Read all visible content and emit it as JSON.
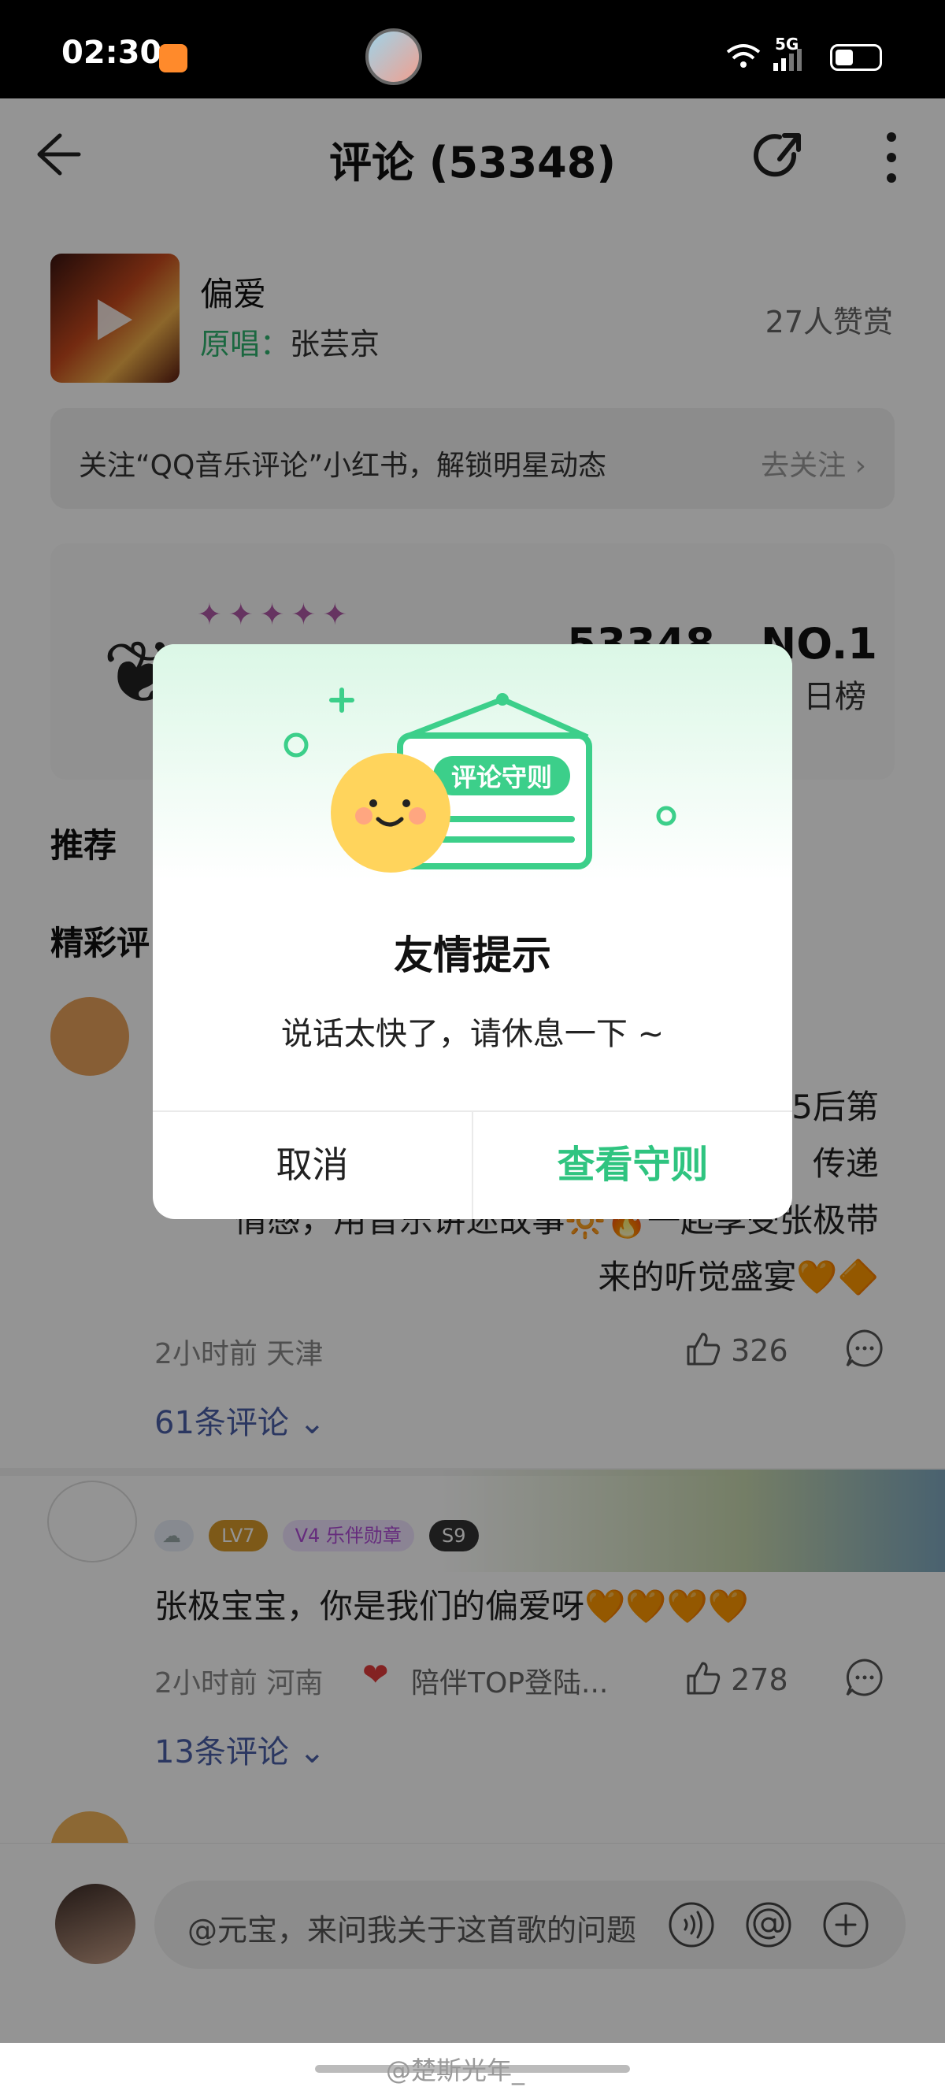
{
  "status_bar": {
    "time": "02:30",
    "network": "5G"
  },
  "header": {
    "title": "评论 (53348)"
  },
  "song": {
    "title": "偏爱",
    "original_label": "原唱：",
    "singer": "张芸京",
    "likes": "27人赞赏"
  },
  "follow_banner": {
    "text": "关注“QQ音乐评论”小红书，解锁明星动态",
    "action": "去关注 ›"
  },
  "stats": {
    "stars": "✦✦✦✦✦",
    "count": "53348",
    "rank": "NO.1",
    "rank_label": "日榜"
  },
  "sections": {
    "recommend": "推荐",
    "hot": "精彩评"
  },
  "comments": [
    {
      "text_visible": "5后第\n传递\n情感，用音乐讲述故事🔆🔥一起享受张极带\n来的听觉盛宴🧡🔶",
      "time_place": "2小时前 天津",
      "likes": "326",
      "replies": "61条评论 ⌄"
    },
    {
      "badges": [
        "☁",
        "LV7",
        "V4 乐伴勋章",
        "S9"
      ],
      "text": "张极宝宝，你是我们的偏爱呀🧡🧡🧡🧡",
      "time_place": "2小时前 河南",
      "heart": "❤",
      "tag": "陪伴TOP登陆...",
      "likes": "278",
      "replies": "13条评论 ⌄"
    }
  ],
  "input": {
    "placeholder": "@元宝，来问我关于这首歌的问题"
  },
  "watermark": "@楚斯光年_",
  "dialog": {
    "sign_text": "评论守则",
    "title": "友情提示",
    "message": "说话太快了，请休息一下 ~",
    "cancel": "取消",
    "confirm": "查看守则"
  },
  "colors": {
    "accent_green": "#2fc480",
    "link_blue": "#4a5fa8",
    "overlay": "rgba(0,0,0,0.42)"
  }
}
